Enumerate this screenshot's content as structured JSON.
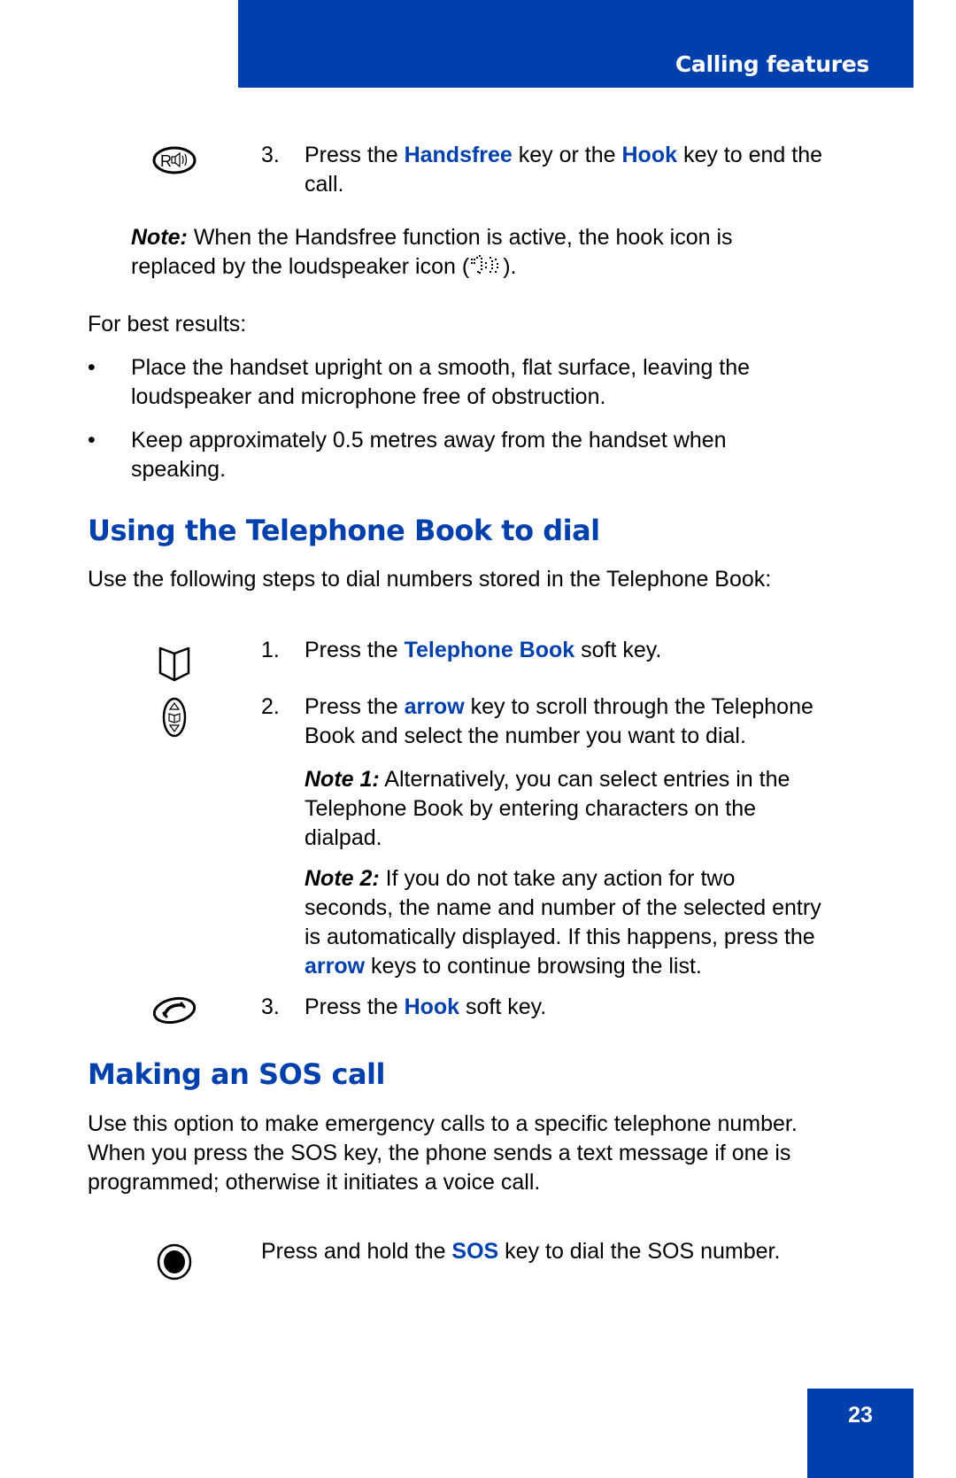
{
  "header": {
    "section_title": "Calling features"
  },
  "colors": {
    "brand_blue": "#0040ad",
    "text": "#000000",
    "background": "#ffffff"
  },
  "top_step": {
    "number": "3.",
    "icon": "handsfree-key-icon",
    "line1_pre": "Press the ",
    "kw1": "Handsfree",
    "line1_mid": " key or the ",
    "kw2": "Hook",
    "line1_post": " key to end the",
    "line2": "call."
  },
  "handsfree_note": {
    "label": "Note:",
    "line1": " When the Handsfree function is active, the hook icon is",
    "line2_pre": "replaced by the loudspeaker icon (",
    "icon": "loudspeaker-icon",
    "line2_post": ")."
  },
  "best_results": {
    "intro": "For best results:",
    "bullets": [
      {
        "lines": [
          "Place the handset upright on a smooth, flat surface, leaving the",
          "loudspeaker and microphone free of obstruction."
        ]
      },
      {
        "lines": [
          "Keep approximately 0.5 metres away from the handset when",
          "speaking."
        ]
      }
    ],
    "bullet_glyph": "•"
  },
  "telephone_book": {
    "heading": "Using the Telephone Book to dial",
    "intro": "Use the following steps to dial numbers stored in the Telephone Book:",
    "step1": {
      "number": "1.",
      "icon": "telephone-book-icon",
      "pre": "Press the ",
      "kw": "Telephone Book",
      "post": " soft key."
    },
    "step2": {
      "number": "2.",
      "icon": "arrow-key-icon",
      "pre": "Press the ",
      "kw": "arrow",
      "post": " key to scroll through the Telephone",
      "line2": "Book and select the number you want to dial."
    },
    "note1": {
      "label": "Note 1:",
      "line1": " Alternatively, you can select entries in the",
      "line2": "Telephone Book by entering characters on the",
      "line3": "dialpad."
    },
    "note2": {
      "label": "Note 2:",
      "line1": " If you do not take any action for two",
      "line2": "seconds, the name and number of the selected entry",
      "line3": "is automatically displayed. If this happens, press the",
      "kw": "arrow",
      "line4_post": " keys to continue browsing the list."
    },
    "step3": {
      "number": "3.",
      "icon": "hook-key-icon",
      "pre": "Press the ",
      "kw": "Hook",
      "post": " soft key."
    }
  },
  "sos": {
    "heading": "Making an SOS call",
    "para": [
      "Use this option to make emergency calls to a specific telephone number.",
      "When you press the SOS key, the phone sends a text message if one is",
      "programmed; otherwise it initiates a voice call."
    ],
    "step": {
      "icon": "sos-key-icon",
      "pre": "Press and hold the ",
      "kw": "SOS",
      "post": " key to dial the SOS number."
    }
  },
  "footer": {
    "page_number": "23"
  }
}
